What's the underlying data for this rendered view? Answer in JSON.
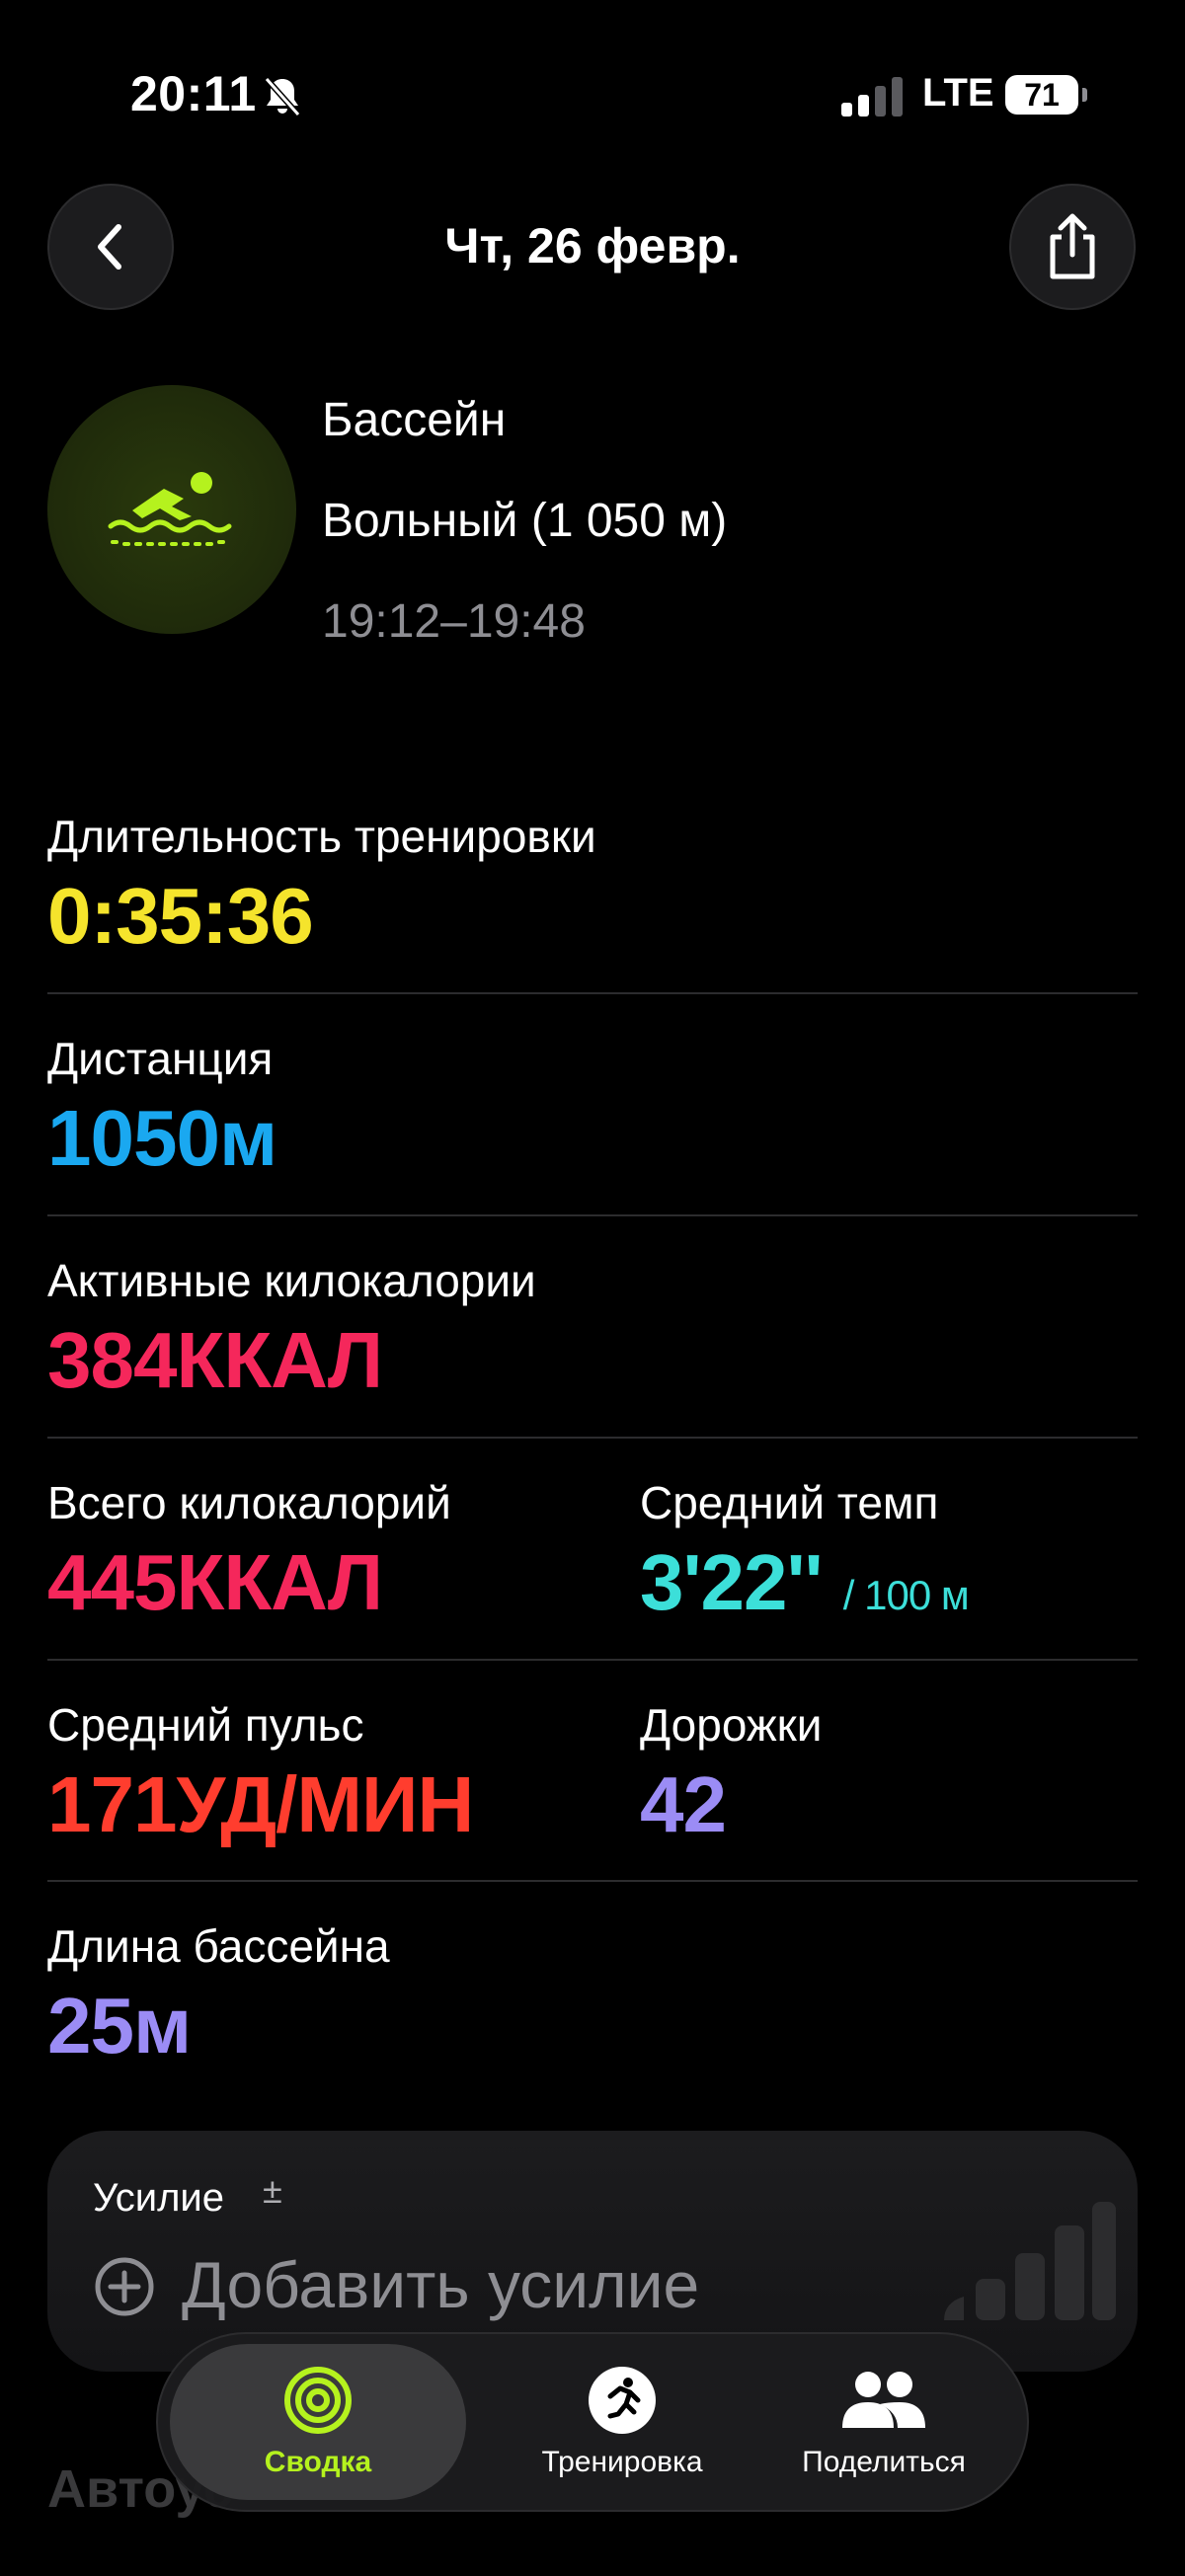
{
  "status": {
    "time": "20:11",
    "network": "LTE",
    "battery": "71"
  },
  "header": {
    "title": "Чт, 26 февр."
  },
  "workout": {
    "name": "Бассейн",
    "stroke": "Вольный (1 050 м)",
    "time_range": "19:12–19:48",
    "accent_color": "#b5f21e"
  },
  "metrics": {
    "duration": {
      "label": "Длительность тренировки",
      "value": "0:35:36",
      "color": "#f5e42c"
    },
    "distance": {
      "label": "Дистанция",
      "value": "1050",
      "unit": "м",
      "color": "#1aa8f0"
    },
    "active_kcal": {
      "label": "Активные килокалории",
      "value": "384",
      "unit": "ККАЛ",
      "color": "#f5275b"
    },
    "total_kcal": {
      "label": "Всего килокалорий",
      "value": "445",
      "unit": "ККАЛ",
      "color": "#f5275b"
    },
    "avg_pace": {
      "label": "Средний темп",
      "value": "3'22''",
      "unit": "/ 100 м",
      "color": "#3cdfd9"
    },
    "avg_hr": {
      "label": "Средний пульс",
      "value": "171",
      "unit": "УД/МИН",
      "color": "#ff3d2e"
    },
    "laps": {
      "label": "Дорожки",
      "value": "42",
      "color": "#9b8cf5"
    },
    "pool_length": {
      "label": "Длина бассейна",
      "value": "25",
      "unit": "м",
      "color": "#9b8cf5"
    }
  },
  "effort": {
    "label": "Усилие",
    "pm_symbol": "±",
    "add_label": "Добавить усилие"
  },
  "below": {
    "partial_header": "Автоус"
  },
  "tabs": [
    {
      "label": "Сводка",
      "icon": "activity-rings-icon",
      "active": true
    },
    {
      "label": "Тренировка",
      "icon": "runner-icon",
      "active": false
    },
    {
      "label": "Поделиться",
      "icon": "people-icon",
      "active": false
    }
  ]
}
